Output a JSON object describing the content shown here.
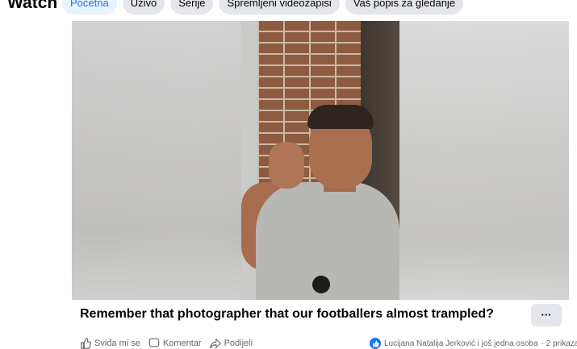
{
  "header": {
    "title": "Watch",
    "tabs": [
      {
        "label": "Početna",
        "active": true
      },
      {
        "label": "Uživo",
        "active": false
      },
      {
        "label": "Serije",
        "active": false
      },
      {
        "label": "Spremljeni videozapisi",
        "active": false
      },
      {
        "label": "Vaš popis za gledanje",
        "active": false
      }
    ]
  },
  "post": {
    "title": "Remember that photographer that our footballers almost trampled?",
    "more_label": "···",
    "actions": {
      "like_label": "Sviđa mi se",
      "comment_label": "Komentar",
      "share_label": "Podijeli"
    },
    "reactions_text": "Lucijana Natalija Jerković i još jedna osoba",
    "views_text": "· 2 prikaza"
  },
  "colors": {
    "accent": "#1877f2",
    "tab_bg": "#e4e6eb",
    "active_tab_bg": "#e7f3ff",
    "secondary_text": "#65676b"
  }
}
